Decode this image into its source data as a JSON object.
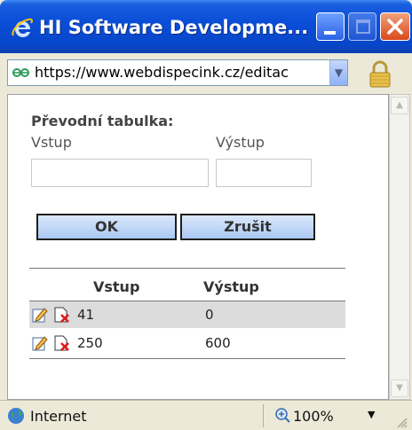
{
  "window": {
    "title": "HI Software Developme...",
    "buttons": {
      "minimize": "minimize",
      "maximize": "maximize",
      "close": "close"
    }
  },
  "address_bar": {
    "url": "https://www.webdispecink.cz/editac"
  },
  "form": {
    "title": "Převodní tabulka:",
    "input_label": "Vstup",
    "output_label": "Výstup",
    "input_value": "",
    "output_value": "",
    "ok_label": "OK",
    "cancel_label": "Zrušit"
  },
  "table": {
    "headers": [
      "Vstup",
      "Výstup"
    ],
    "rows": [
      {
        "vstup": "41",
        "vystup": "0"
      },
      {
        "vstup": "250",
        "vystup": "600"
      }
    ]
  },
  "status_bar": {
    "zone": "Internet",
    "zoom": "100%"
  },
  "colors": {
    "title_bar": "#0a4ed8",
    "button_bg": "#a9c8f3",
    "row_alt": "#dcdcdc"
  }
}
